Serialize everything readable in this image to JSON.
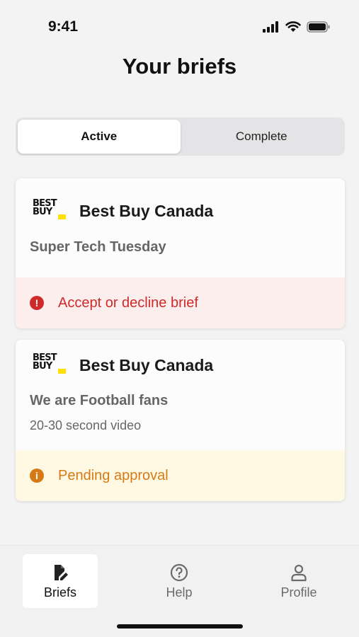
{
  "status_bar": {
    "time": "9:41",
    "icons": [
      "signal-icon",
      "wifi-icon",
      "battery-icon"
    ]
  },
  "header": {
    "title": "Your briefs"
  },
  "segments": {
    "active_label": "Active",
    "complete_label": "Complete",
    "selected": "Active"
  },
  "briefs": [
    {
      "brand_logo_text": "BEST BUY",
      "brand": "Best Buy Canada",
      "title": "Super Tech Tuesday",
      "meta": "",
      "status": "Accept or decline brief",
      "status_icon": "!",
      "status_type": "danger"
    },
    {
      "brand_logo_text": "BEST BUY",
      "brand": "Best Buy Canada",
      "title": "We are Football fans",
      "meta": "20-30 second video",
      "status": "Pending approval",
      "status_icon": "i",
      "status_type": "warning"
    }
  ],
  "tabbar": {
    "items": [
      {
        "label": "Briefs",
        "icon": "document-edit-icon",
        "active": true
      },
      {
        "label": "Help",
        "icon": "question-circle-icon",
        "active": false
      },
      {
        "label": "Profile",
        "icon": "person-icon",
        "active": false
      }
    ]
  },
  "colors": {
    "danger": "#cf2a2a",
    "danger_bg": "#fdeeee",
    "warning": "#d77a16",
    "warning_bg": "#fff8e2",
    "brand_yellow": "#ffe000"
  }
}
